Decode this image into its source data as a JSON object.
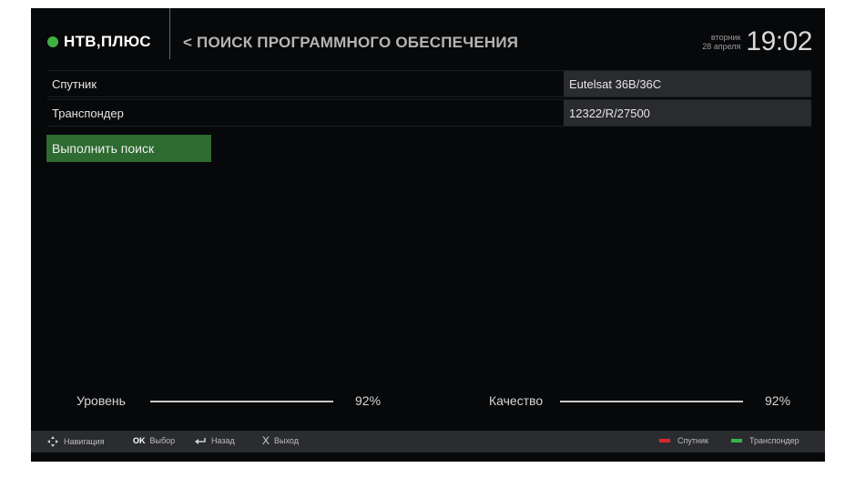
{
  "header": {
    "logo_text": "НТВ,ПЛЮС",
    "page_title": "< ПОИСК ПРОГРАММНОГО ОБЕСПЕЧЕНИЯ",
    "weekday": "вторник",
    "date": "28 апреля",
    "time": "19:02"
  },
  "form": {
    "satellite": {
      "label": "Спутник",
      "value": "Eutelsat  36B/36C"
    },
    "transponder": {
      "label": "Транспондер",
      "value": "12322/R/27500"
    }
  },
  "search_button": {
    "label": "Выполнить поиск"
  },
  "signal": {
    "level": {
      "label": "Уровень",
      "value": "92%",
      "fraction": 0.92
    },
    "quality": {
      "label": "Качество",
      "value": "92%",
      "fraction": 0.92
    }
  },
  "footer": {
    "navigation_icon": "dpad-icon",
    "navigation": "Навигация",
    "ok_key": "OK",
    "select": "Выбор",
    "back_icon": "back-arrow-icon",
    "back": "Назад",
    "exit_key": "X",
    "exit": "Выход",
    "red_hint": "Спутник",
    "green_hint": "Транспондер"
  },
  "colors": {
    "brand_green": "#3fb041",
    "button_green": "#2e6b30",
    "red_key": "#d8282c",
    "green_key": "#34b549",
    "background": "#07080a"
  }
}
